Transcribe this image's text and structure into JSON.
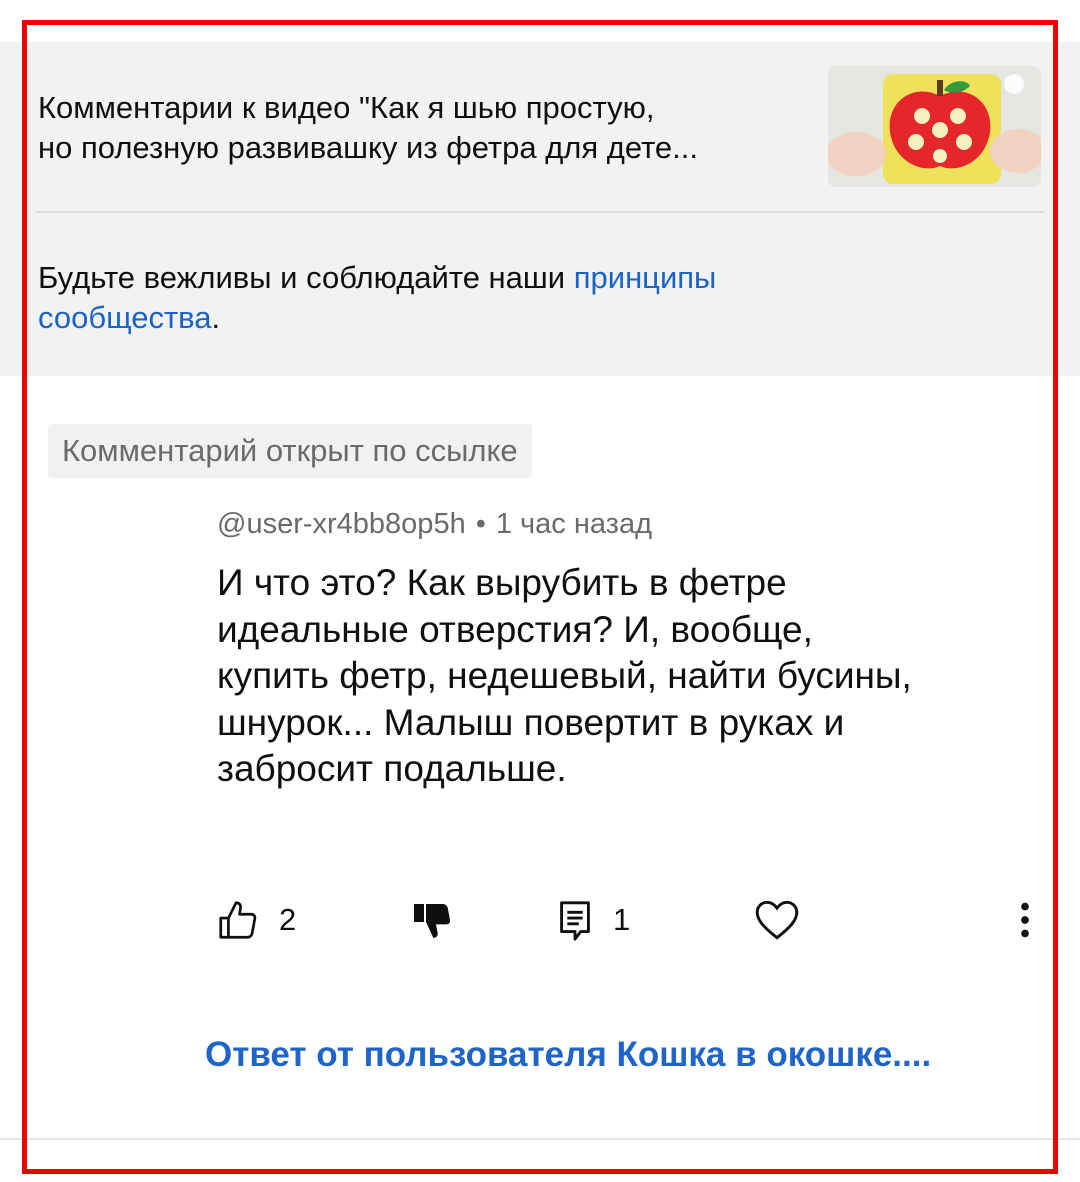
{
  "header": {
    "video_title_line1": "Комментарии к видео \"Как я шью простую,",
    "video_title_line2": "но полезную развивашку из фетра для дете...",
    "rules_text": "Будьте вежливы и соблюдайте наши ",
    "rules_link_line1": "принципы",
    "rules_link_line2": "сообщества",
    "rules_period": "."
  },
  "comment": {
    "badge": "Комментарий открыт по ссылке",
    "author": "@user-xr4bb8op5h",
    "separator": "•",
    "time": "1 час назад",
    "lines": [
      "И что  это?  Как вырубить в фетре",
      "идеальные отверстия? И, вообще,",
      "купить фетр, недешевый, найти бусины,",
      "шнурок... Малыш повертит в руках и",
      "забросит подальше."
    ],
    "likes": "2",
    "replies": "1",
    "reply_link": "Ответ от пользователя Кошка в окошке...."
  },
  "colors": {
    "link_blue": "#1a63c7",
    "header_gray": "#f2f2f2",
    "frame_red": "#ee0000"
  },
  "icons": [
    "like-icon",
    "dislike-icon",
    "reply-icon",
    "heart-icon",
    "more-vert-icon"
  ]
}
